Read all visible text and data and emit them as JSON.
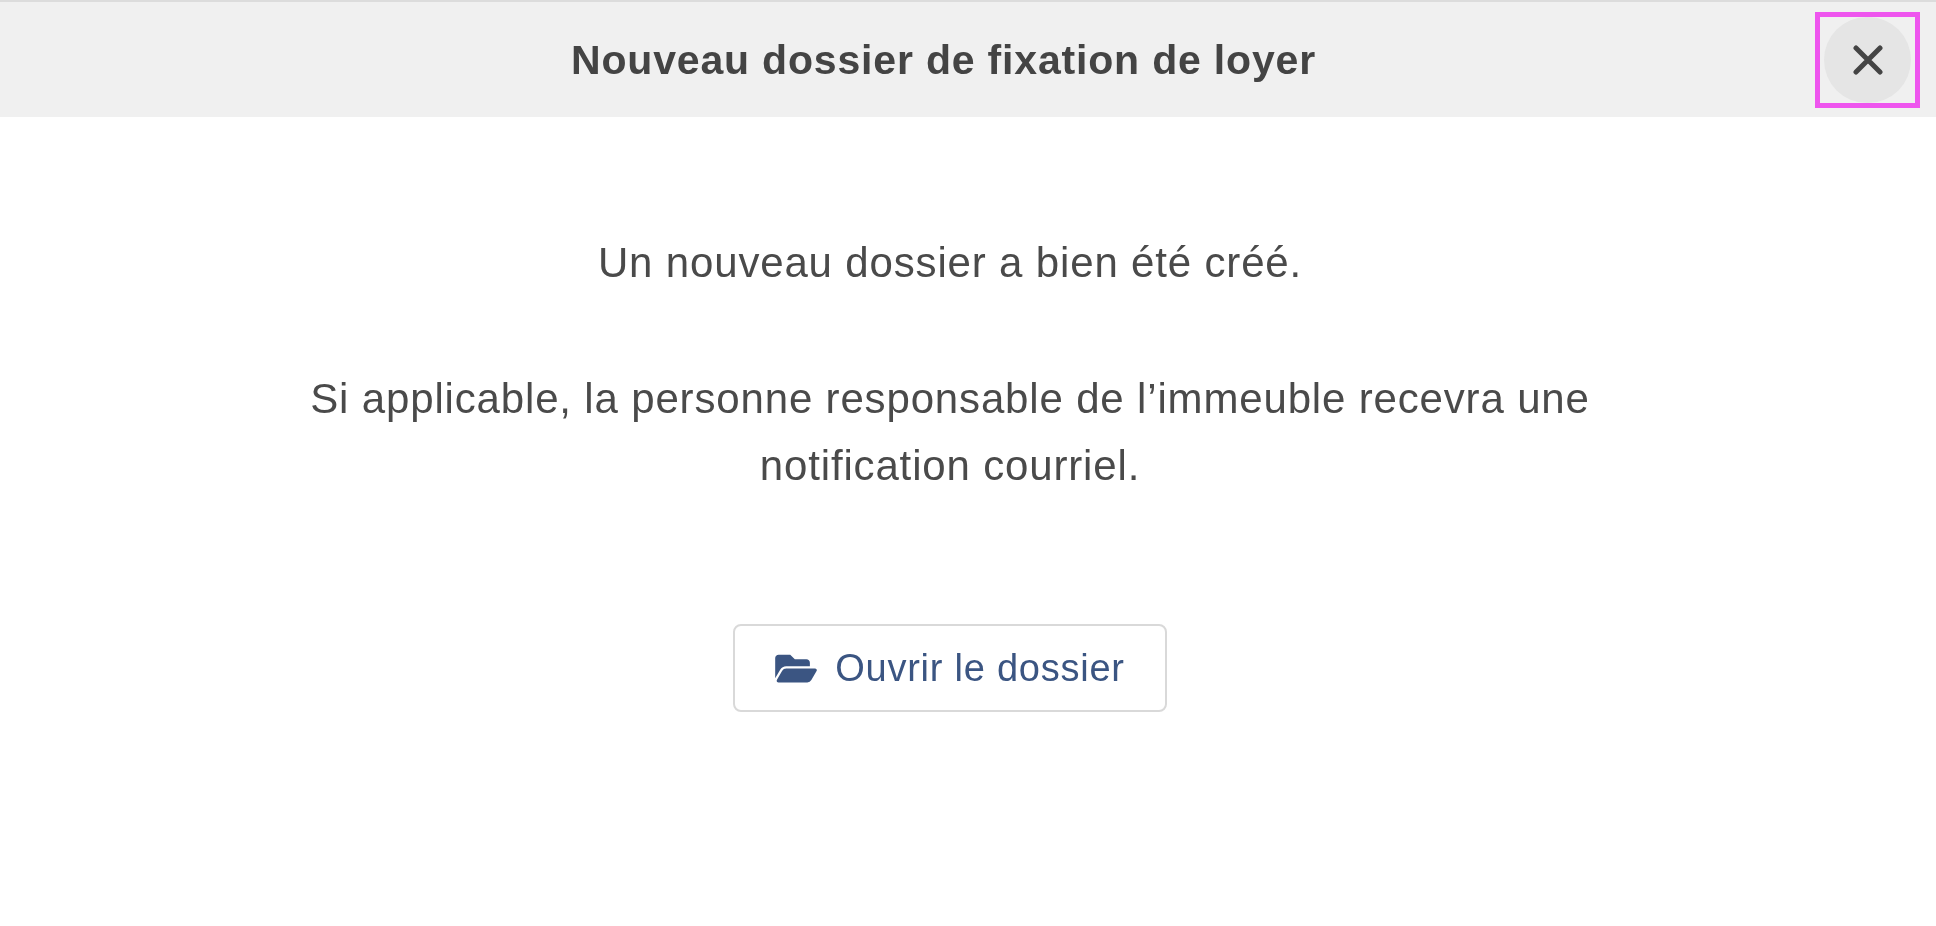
{
  "dialog": {
    "title": "Nouveau dossier de fixation de loyer",
    "close_button": {
      "focused": true
    }
  },
  "messages": [
    "Un nouveau dossier a bien été créé.",
    "Si applicable, la personne responsable de l’immeuble recevra une notification courriel."
  ],
  "buttons": [
    {
      "label": "Ouvrir le dossier"
    }
  ]
}
